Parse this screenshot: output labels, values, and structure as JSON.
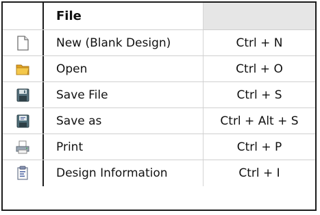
{
  "header": {
    "title": "File",
    "shortcut_header": ""
  },
  "items": [
    {
      "label": "New (Blank Design)",
      "shortcut": "Ctrl + N",
      "icon": "blank-document-icon"
    },
    {
      "label": "Open",
      "shortcut": "Ctrl + O",
      "icon": "folder-icon"
    },
    {
      "label": "Save File",
      "shortcut": "Ctrl + S",
      "icon": "floppy-disk-icon"
    },
    {
      "label": "Save as",
      "shortcut": "Ctrl + Alt + S",
      "icon": "floppy-disk-save-as-icon"
    },
    {
      "label": "Print",
      "shortcut": "Ctrl + P",
      "icon": "printer-icon"
    },
    {
      "label": "Design Information",
      "shortcut": "Ctrl + I",
      "icon": "design-information-icon"
    }
  ],
  "colors": {
    "header_shade": "#e6e6e6",
    "border": "#1a1a1a",
    "folder": "#f0c240",
    "floppy": "#55727f"
  }
}
